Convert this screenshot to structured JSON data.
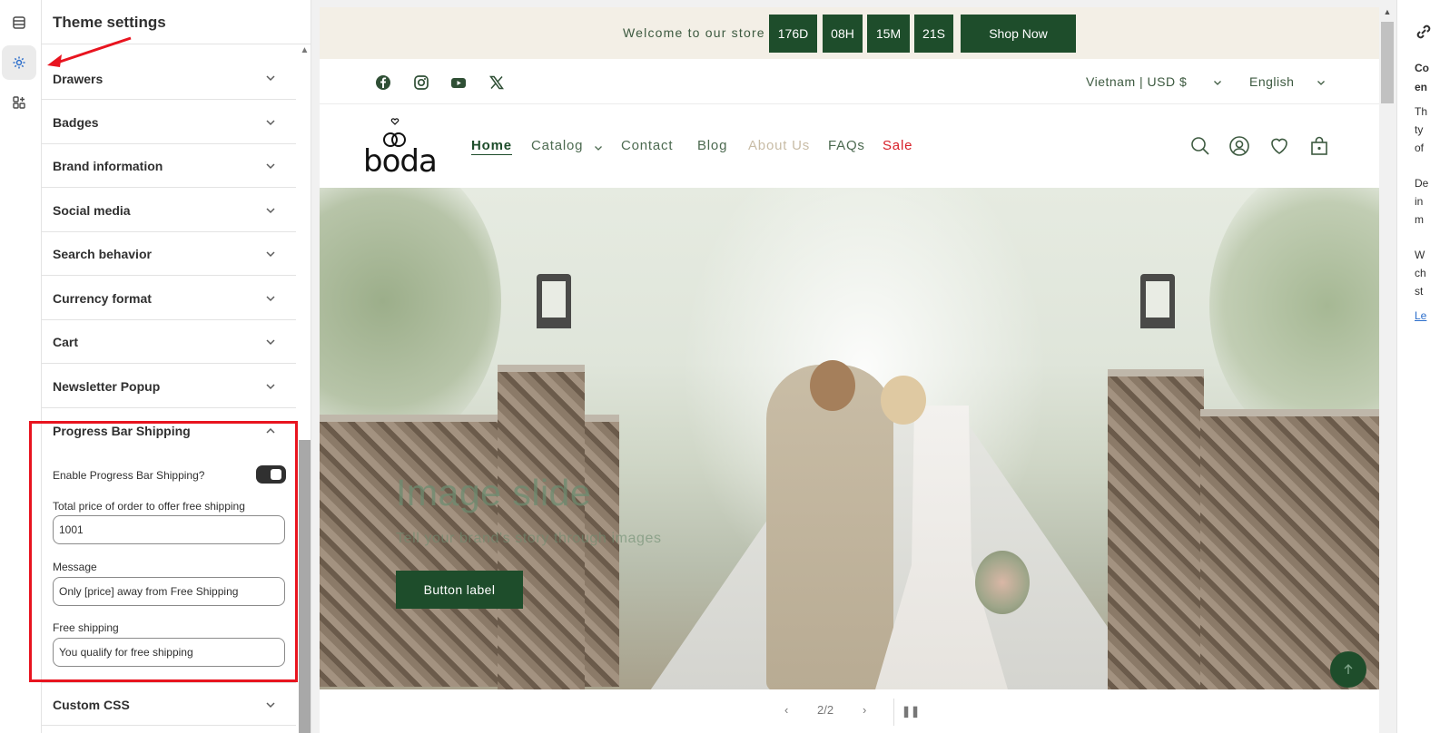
{
  "rail": {
    "items": [
      "sections-icon",
      "theme-settings-icon",
      "apps-icon"
    ]
  },
  "panel": {
    "title": "Theme settings",
    "sections": [
      {
        "label": "Drawers"
      },
      {
        "label": "Badges"
      },
      {
        "label": "Brand information"
      },
      {
        "label": "Social media"
      },
      {
        "label": "Search behavior"
      },
      {
        "label": "Currency format"
      },
      {
        "label": "Cart"
      },
      {
        "label": "Newsletter Popup"
      }
    ],
    "progress_bar": {
      "label": "Progress Bar Shipping",
      "enable_label": "Enable Progress Bar Shipping?",
      "enabled": true,
      "total_price_label": "Total price of order to offer free shipping",
      "total_price_value": "1001",
      "message_label": "Message",
      "message_value": "Only [price] away from Free Shipping",
      "free_shipping_label": "Free shipping",
      "free_shipping_value": "You qualify for free shipping"
    },
    "custom_css": {
      "label": "Custom CSS"
    }
  },
  "preview": {
    "announcement": {
      "text": "Welcome to our store",
      "countdown": [
        "176D",
        "08H",
        "15M",
        "21S"
      ],
      "button": "Shop Now"
    },
    "region": "Vietnam | USD $",
    "language": "English",
    "logo": "boda",
    "nav": [
      "Home",
      "Catalog",
      "Contact",
      "Blog",
      "About Us",
      "FAQs",
      "Sale"
    ],
    "hero": {
      "title": "Image slide",
      "subtitle": "Tell your brand's story through images",
      "button": "Button label"
    },
    "slider": {
      "counter": "2/2",
      "prev": "‹",
      "next": "›",
      "pause": "❚❚"
    }
  },
  "right_panel": {
    "lines": [
      "Co",
      "en",
      "Th",
      "ty",
      "of",
      "De",
      "in",
      "m",
      "W",
      "ch",
      "st",
      "Le"
    ]
  },
  "colors": {
    "brand_green": "#1e4d2b",
    "sale_red": "#d71e28",
    "highlight_red": "#e8141f"
  }
}
